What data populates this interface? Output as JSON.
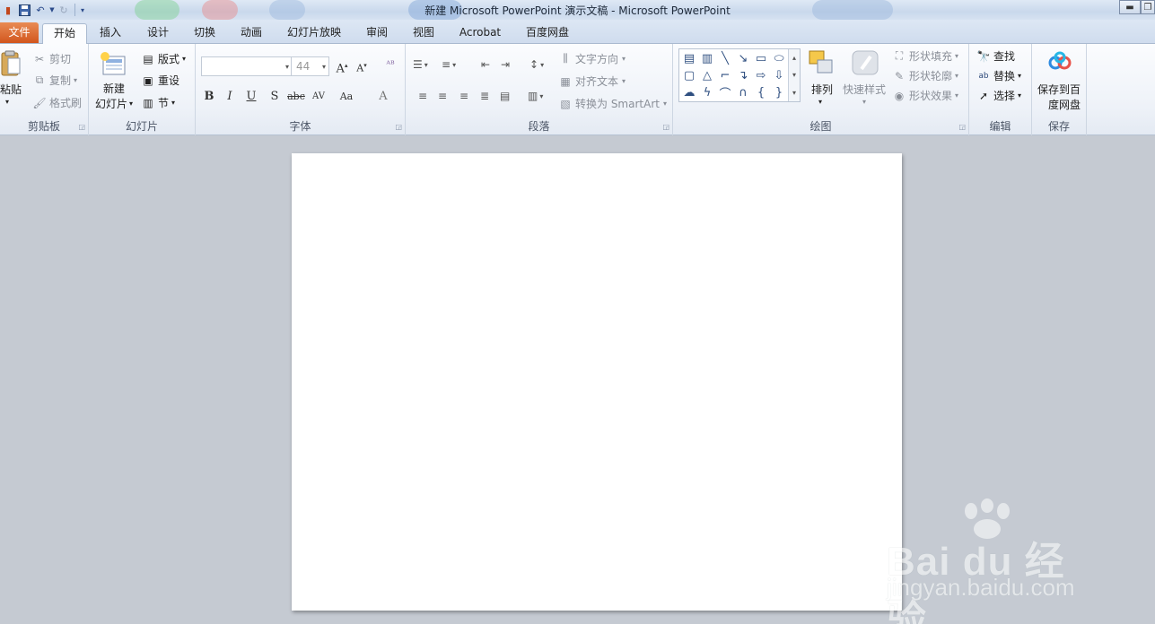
{
  "window": {
    "title": "新建 Microsoft PowerPoint 演示文稿 - Microsoft PowerPoint"
  },
  "tabs": [
    {
      "label": "文件"
    },
    {
      "label": "开始"
    },
    {
      "label": "插入"
    },
    {
      "label": "设计"
    },
    {
      "label": "切换"
    },
    {
      "label": "动画"
    },
    {
      "label": "幻灯片放映"
    },
    {
      "label": "审阅"
    },
    {
      "label": "视图"
    },
    {
      "label": "Acrobat"
    },
    {
      "label": "百度网盘"
    }
  ],
  "ribbon": {
    "clipboard": {
      "label": "剪贴板",
      "paste": "粘贴",
      "cut": "剪切",
      "copy": "复制",
      "format_painter": "格式刷"
    },
    "slides": {
      "label": "幻灯片",
      "new_slide_line1": "新建",
      "new_slide_line2": "幻灯片",
      "layout": "版式",
      "reset": "重设",
      "section": "节"
    },
    "font": {
      "label": "字体",
      "font_name": "",
      "font_size": "44",
      "bold": "B",
      "italic": "I",
      "underline": "U",
      "shadow": "S",
      "strike": "abc",
      "spacing": "AV",
      "case": "Aa",
      "color": "A"
    },
    "paragraph": {
      "label": "段落",
      "text_direction": "文字方向",
      "align_text": "对齐文本",
      "convert_smartart": "转换为 SmartArt"
    },
    "drawing": {
      "label": "绘图",
      "arrange": "排列",
      "quick_styles": "快速样式",
      "shape_fill": "形状填充",
      "shape_outline": "形状轮廓",
      "shape_effects": "形状效果"
    },
    "editing": {
      "label": "编辑",
      "find": "查找",
      "replace": "替换",
      "select": "选择"
    },
    "save": {
      "label": "保存",
      "save_baidu_line1": "保存到百",
      "save_baidu_line2": "度网盘"
    }
  },
  "watermark": {
    "text": "Bai du 经验",
    "url": "jingyan.baidu.com"
  },
  "colors": {
    "file_tab": "#d2561e",
    "workspace": "#c5cad2",
    "ribbon_bg": "#eef2f8"
  }
}
